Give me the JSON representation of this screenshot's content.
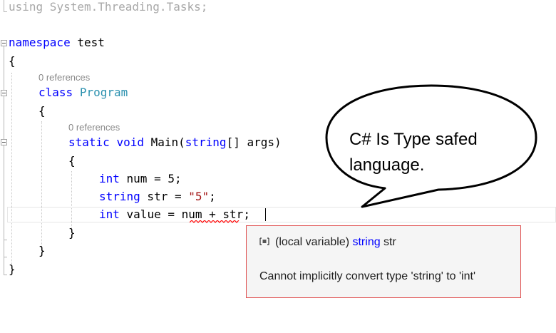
{
  "code": {
    "using_kw": "using",
    "using_ns": " System.Threading.Tasks;",
    "namespace_kw": "namespace",
    "namespace_name": " test",
    "brace_open": "{",
    "brace_close": "}",
    "class_kw": "class",
    "class_name": "Program",
    "static_kw": "static",
    "void_kw": "void",
    "main_sig_a": " Main(",
    "string_kw": "string",
    "main_sig_b": "[] args)",
    "int_kw": "int",
    "num_decl": " num = 5;",
    "str_decl_a": " str = ",
    "str_literal": "\"5\"",
    "semicolon": ";",
    "value_decl_a": " value = ",
    "num_expr": "num + str",
    "references_label": "0 references"
  },
  "callout": {
    "text_line1": "C# Is Type safed",
    "text_line2": "language."
  },
  "tooltip": {
    "icon": "local-variable-icon",
    "prefix": "(local variable) ",
    "type": "string",
    "name": " str",
    "error": "Cannot implicitly convert type 'string' to 'int'"
  },
  "colors": {
    "keyword": "#0000ff",
    "type_name": "#2b91af",
    "string_literal": "#a31515",
    "error_squiggle": "#ff0000",
    "tooltip_border": "#e05050"
  }
}
